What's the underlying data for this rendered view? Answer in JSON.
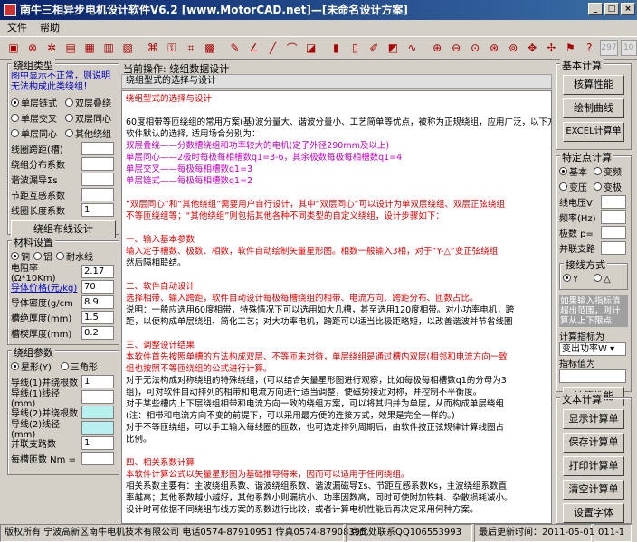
{
  "title": "南牛三相异步电机设计软件V6.2  [www.MotorCAD.net]—[未命名设计方案]",
  "menu": [
    "文件",
    "帮助"
  ],
  "toolbar_disabled": [
    "297",
    "10"
  ],
  "winding_type": {
    "caption": "绕组类型",
    "note": "图中显示不正常，则说明无法构成此类绕组！",
    "options": [
      [
        "单层链式",
        "双层叠绕"
      ],
      [
        "单层交叉",
        "双层同心"
      ],
      [
        "单层同心",
        "其他绕组"
      ]
    ],
    "selected": "单层链式",
    "fields": [
      {
        "label": "线圈跨距(槽)",
        "value": ""
      },
      {
        "label": "绕组分布系数",
        "value": ""
      },
      {
        "label": "谐波漏导Σs",
        "value": ""
      },
      {
        "label": "节距互感系数",
        "value": ""
      },
      {
        "label": "线圈长度系数",
        "value": "1"
      }
    ],
    "button": "绕组布线设计"
  },
  "material": {
    "caption": "材料设置",
    "options": [
      "铜",
      "铝",
      "耐水线"
    ],
    "selected": "铜",
    "fields": [
      {
        "label": "电阻率(Ω*10Km)",
        "value": "2.17"
      },
      {
        "label": "导体价格(元/kg)",
        "value": "70"
      },
      {
        "label": "导体密度(g/cm",
        "value": "8.9"
      },
      {
        "label": "槽绝厚度(mm)",
        "value": "1.5"
      },
      {
        "label": "槽楔厚度(mm)",
        "value": "0.2"
      }
    ]
  },
  "winding_params": {
    "caption": "绕组参数",
    "options": [
      "星形(Y)",
      "三角形"
    ],
    "selected": "星形(Y)",
    "fields": [
      {
        "label": "导线(1)并绕根数",
        "value": "1"
      },
      {
        "label": "导线(1)线径(mm)",
        "value": ""
      },
      {
        "label": "导线(2)并绕根数",
        "value": ""
      },
      {
        "label": "导线(2)线径(mm)",
        "value": ""
      },
      {
        "label": "并联支路数",
        "value": "1"
      },
      {
        "label": "每槽匝数 Nm =",
        "value": ""
      }
    ]
  },
  "center": {
    "op_label": "当前操作: 绕组数据设计",
    "tab": "绕组型式的选择与设计"
  },
  "doc": {
    "intro": "60度相带等匝绕组的常用方案(基)波分量大、谐波分量小、工艺简单等优点，被称为正规绕组，应用广泛，以下方案",
    "intro2": "软件默认的选择, 适用场合分别为：",
    "items": [
      "双层叠绕——分数槽绕组和功率较大的电机(定子外径290mm及以上)",
      "单层同心——2极时每极每相槽数q1=3-6，其余极数每极每相槽数q1=4",
      "单层交叉——每极每相槽数q1=3",
      "单层链式——每极每相槽数q1=2"
    ],
    "para1": "“双层同心”和“其他绕组”需要用户自行设计，其中“双层同心”可以设计为单双层绕组、双层正弦绕组",
    "para1b": "不等匝绕组等；“其他绕组”则包括其他各种不同类型的自定义绕组，设计步骤如下：",
    "h1": "一、输入基本参数",
    "h1t": "输入定子槽数、极数、相数，软件自动绘制矢量星形图。相数一般输入3相，对于“Y-△”变正弦绕组",
    "h1t2": "然后隔相联结。",
    "h2": "二、软件自动设计",
    "h2t": "选择相带、输入跨距，软件自动设计每极每槽绕组的相带、电流方向、跨距分布、匝数占比。",
    "h2t2": "说明：一般应选用60度相带，特殊情况下可以选用如大几槽，甚至选用120度相带。对小功率电机，跨",
    "h2t3": "距，以便构成单层绕组、简化工艺；对大功率电机，跨距可以适当比极距略短，以改善谐波并节省线圈",
    "h3": "三、调整设计结果",
    "h3t": "本软件首先按照单槽的方法构成双层、不等匝未对待，单层绕组是通过槽内双层(相邻和电流方向一致",
    "h3t2": "组也按照不等匝绕组的公式进行计算。",
    "h3t3": "对于无法构成对称绕组的特殊绕组，(可以结合矢量星形图进行观察，比如每极每相槽数q1的分母为3",
    "h3t4": "组)，可对软件自动排列的相带和电流方向进行适当调整，使磁势接近对称，并控制不平衡度。",
    "h3t5": "对于某些槽内上下层绕组相带和电流方向一致的绕组方案，可以将其归并为单层，从而构成单层绕组",
    "h3t6": "(注：相带和电流方向不变的前提下，可以采用最方便的连接方式，效果是完全一样的。)",
    "h3t7": "对于不等匝绕组，可以手工输入每线圈的匝数，也可选定排列周期后，由软件按正弦规律计算线圈占",
    "h3t8": "比例。",
    "h4": "四、相关系数计算",
    "h4t": "本软件计算公式以矢量星形图为基础推导得来，因而可以适用于任何绕组。",
    "h4t2": "相关系数主要有：主波绕组系数、谐波绕组系数、谐波漏磁导Σs、节距互感系数Ks，主波绕组系数直",
    "h4t3": "率越高；其他系数越小越好，其他系数小则漏抗小、功率因数高，同时可使附加铁耗、杂散损耗减小。",
    "h4t4": "设计时可依据不同绕组布线方案的系数进行比较，或者计算电机性能后再决定采用何种方案。"
  },
  "basic_calc": {
    "caption": "基本计算",
    "buttons": [
      "核算性能",
      "绘制曲线",
      "EXCEL计算单"
    ]
  },
  "specific": {
    "caption": "特定点计算",
    "options": [
      [
        "基本",
        "变频"
      ],
      [
        "变压",
        "变极"
      ]
    ],
    "selected": "基本",
    "fields": [
      "线电压V",
      "频率(Hz)",
      "极数 p=",
      "并联支路"
    ],
    "sync_caption": "接线方式",
    "sync_options": [
      "Y",
      "△"
    ],
    "sync_selected": "Y",
    "note": "如果输入指标值超出范围，则计算从上下限点",
    "target_label": "计算指标为",
    "target_value": "变出功率W",
    "target_val_label": "指标值为",
    "calc_button": "计算性能"
  },
  "text_calc": {
    "caption": "文本计算",
    "buttons": [
      "显示计算单",
      "保存计算单",
      "打印计算单",
      "清空计算单",
      "设置字体"
    ]
  },
  "status": [
    "版权所有 宁波高新区南牛电机技术有限公司 电话0574-87910951 传真0574-87908395",
    "点此处联系QQ106553993",
    "最后更新时间：2011-05-01",
    "011-1"
  ]
}
